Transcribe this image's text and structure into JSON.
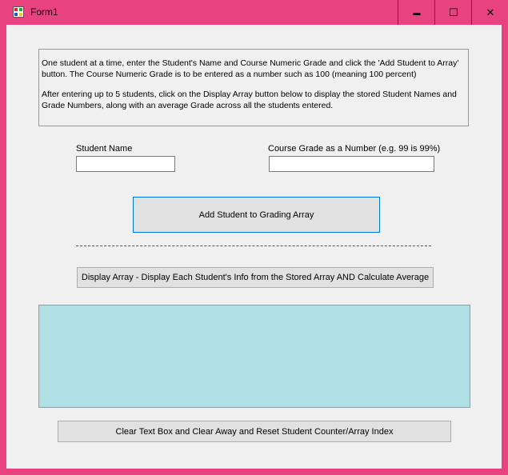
{
  "window": {
    "title": "Form1",
    "minimize_glyph": "▬",
    "maximize_glyph": "☐",
    "close_glyph": "✕",
    "accent": "#e84380"
  },
  "instructions": {
    "paragraph1": "One student at a time, enter the Student's Name and Course Numeric Grade and click the 'Add Student to Array' button. The Course Numeric Grade is to be entered as a number such as 100 (meaning 100 percent)",
    "paragraph2": "After entering up to 5 students, click on the Display Array button below to display the stored Student Names and Grade Numbers, along with an average Grade across all the students entered."
  },
  "form": {
    "student_name_label": "Student Name",
    "student_name_value": "",
    "grade_label": "Course Grade as a Number (e.g. 99 is 99%)",
    "grade_value": ""
  },
  "buttons": {
    "add_student": "Add Student to Grading Array",
    "display_array": "Display Array - Display Each Student's Info from the Stored Array AND Calculate Average",
    "clear": "Clear Text Box and Clear Away and Reset Student Counter/Array Index"
  },
  "output": {
    "text": "",
    "background": "#b0dfe5"
  }
}
